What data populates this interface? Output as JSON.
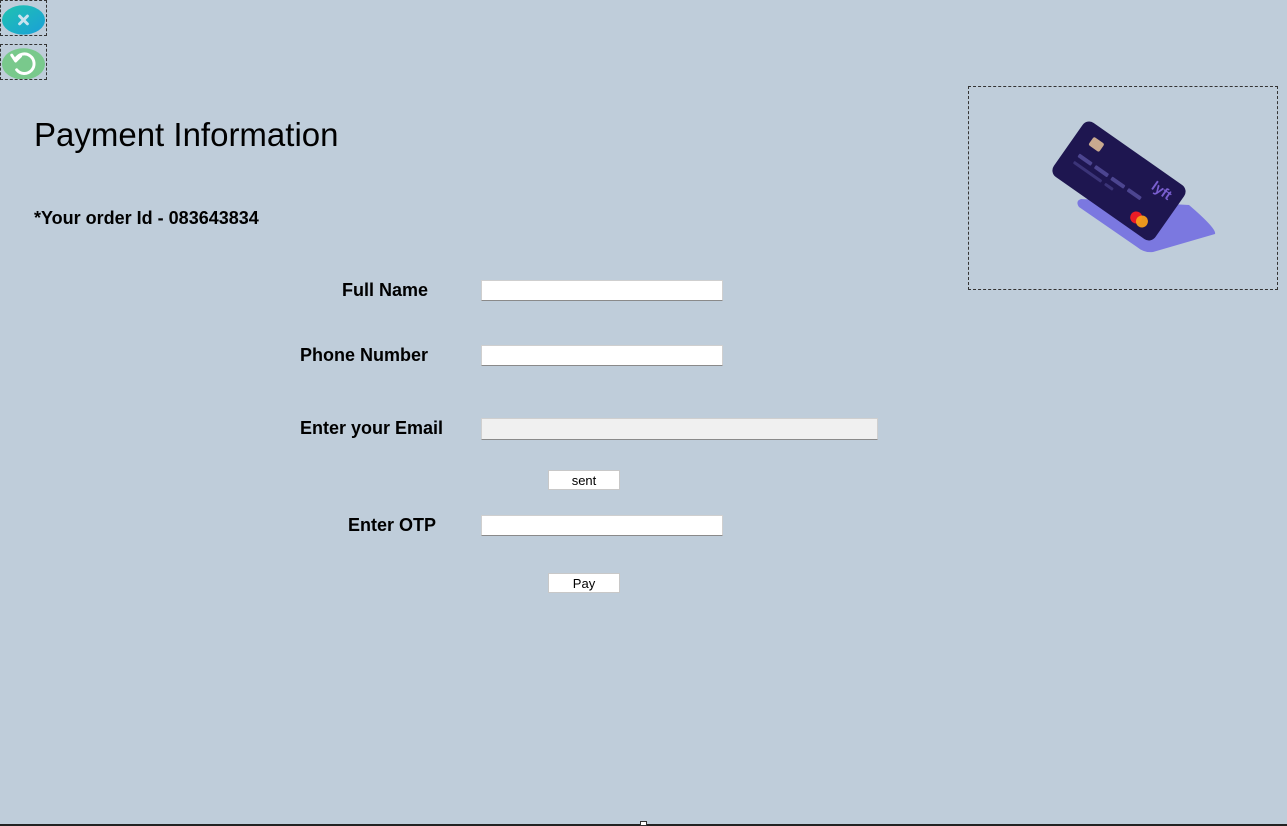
{
  "toolbar": {
    "close_icon": "close-icon",
    "back_icon": "undo-arrow-icon"
  },
  "page": {
    "title": "Payment Information",
    "order_text": "*Your order Id - 083643834"
  },
  "form": {
    "full_name": {
      "label": "Full Name",
      "value": ""
    },
    "phone": {
      "label": "Phone Number",
      "value": ""
    },
    "email": {
      "label": "Enter your Email",
      "value": ""
    },
    "sent_button": "sent",
    "otp": {
      "label": "Enter OTP",
      "value": ""
    },
    "pay_button": "Pay"
  },
  "illustration": {
    "icon": "credit-card-illustration",
    "card_color": "#1e1650",
    "shadow_color": "#7b78e0"
  },
  "colors": {
    "background": "#bfcdda",
    "close_button": "#1fb3c8",
    "back_button": "#79c98c"
  }
}
